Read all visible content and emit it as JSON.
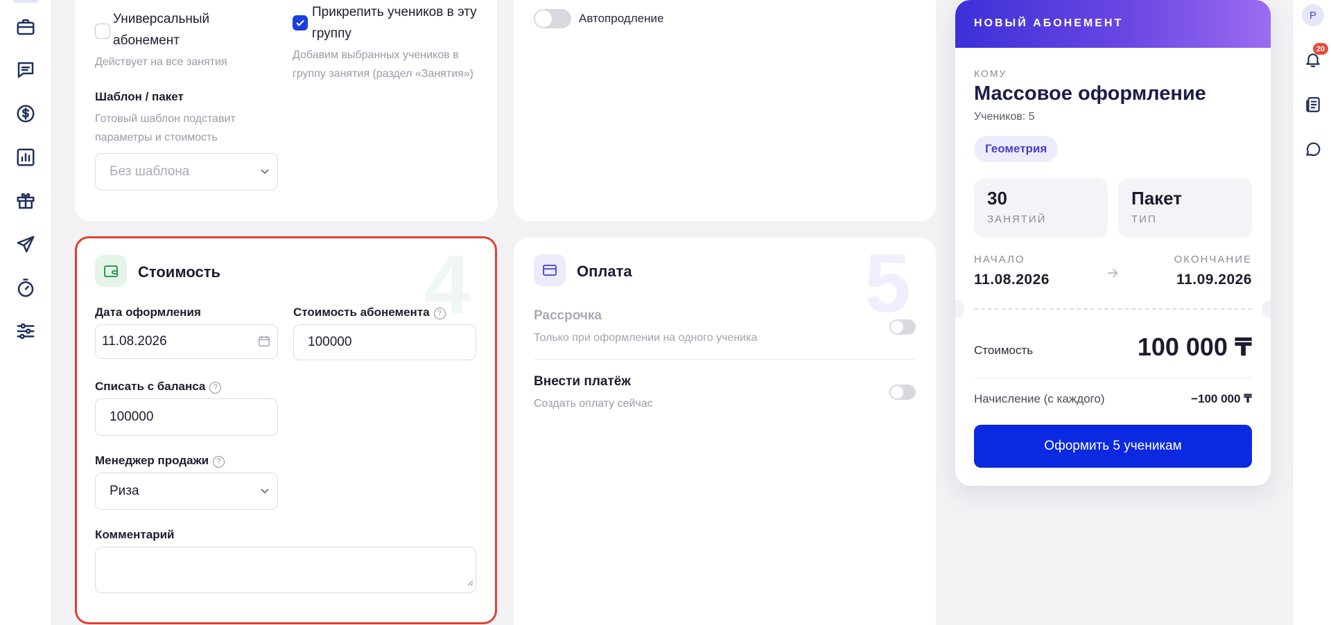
{
  "sidebar": {
    "items": [
      {
        "icon": "briefcase-icon"
      },
      {
        "icon": "chat-list-icon"
      },
      {
        "icon": "dollar-icon"
      },
      {
        "icon": "bar-chart-icon"
      },
      {
        "icon": "gift-icon"
      },
      {
        "icon": "send-icon"
      },
      {
        "icon": "timer-icon"
      },
      {
        "icon": "sliders-icon"
      }
    ]
  },
  "rail": {
    "avatar_initial": "Р",
    "notifications_count": "20"
  },
  "options": {
    "universal": {
      "label": "Универсальный абонемент",
      "hint": "Действует на все занятия",
      "checked": false
    },
    "attach_group": {
      "label": "Прикрепить учеников в эту группу",
      "hint": "Добавим выбранных учеников в группу занятия (раздел «Занятия»)",
      "checked": true
    },
    "template": {
      "label": "Шаблон / пакет",
      "hint": "Готовый шаблон подставит параметры и стоимость",
      "placeholder": "Без шаблона"
    },
    "autorenew": {
      "label": "Автопродление",
      "enabled": false
    }
  },
  "cost_section": {
    "number": "4",
    "title": "Стоимость",
    "date_label": "Дата оформления",
    "date_value": "11.08.2026",
    "price_label": "Стоимость абонемента",
    "price_value": "100000",
    "balance_label": "Списать с баланса",
    "balance_value": "100000",
    "manager_label": "Менеджер продажи",
    "manager_value": "Риза",
    "comment_label": "Комментарий",
    "comment_value": ""
  },
  "payment_section": {
    "number": "5",
    "title": "Оплата",
    "installment_title": "Рассрочка",
    "installment_hint": "Только при оформлении на одного ученика",
    "pay_title": "Внести платёж",
    "pay_hint": "Создать оплату сейчас"
  },
  "summary": {
    "header": "НОВЫЙ АБОНЕМЕНТ",
    "to_caption": "КОМУ",
    "recipient": "Массовое оформление",
    "students": "Учеников: 5",
    "subject_tag": "Геометрия",
    "lessons_value": "30",
    "lessons_caption": "ЗАНЯТИЙ",
    "type_value": "Пакет",
    "type_caption": "ТИП",
    "start_caption": "НАЧАЛО",
    "start_date": "11.08.2026",
    "end_caption": "ОКОНЧАНИЕ",
    "end_date": "11.09.2026",
    "cost_label": "Стоимость",
    "cost_value": "100 000 ₸",
    "charge_label": "Начисление (с каждого)",
    "charge_value": "−100 000 ₸",
    "submit_label": "Оформить 5 ученикам"
  },
  "colors": {
    "accent": "#0a29e0",
    "highlight_border": "#e0412f",
    "header_gradient_start": "#3c30d8",
    "header_gradient_end": "#9a6cf0"
  }
}
